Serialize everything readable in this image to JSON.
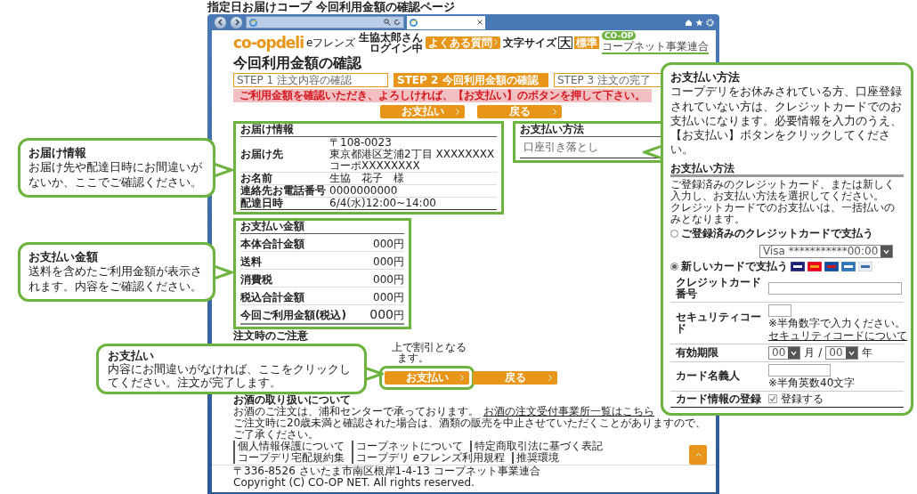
{
  "caption": "指定日お届けコープ 今回利用金額の確認ページ",
  "header": {
    "logo": "co-opdeli",
    "logo_sub": "eフレンズ",
    "user_lines": [
      "生協太郎さん",
      "ログイン中"
    ],
    "faq_button": "よくある質問",
    "font_size_label": "文字サイズ",
    "font_sizes": [
      {
        "label": "大",
        "selected": false
      },
      {
        "label": "標準",
        "selected": true
      }
    ],
    "org_badge": "CO-OP",
    "org_name": "コープネット事業連合"
  },
  "page_title": "今回利用金額の確認",
  "steps": [
    {
      "label": "STEP 1 注文内容の確認",
      "selected": false
    },
    {
      "label": "STEP 2 今回利用金額の確認",
      "selected": true
    },
    {
      "label": "STEP 3 注文の完了",
      "selected": false
    }
  ],
  "alert": "ご利用金額を確認いただき、よろしければ、【お支払い】のボタンを押して下さい。",
  "actions_top": [
    "お支払い",
    "戻る"
  ],
  "delivery": {
    "title": "お届け情報",
    "rows": [
      {
        "label": "お届け先",
        "lines": [
          "〒108-0023",
          "東京都港区芝浦2丁目 XXXXXXXX コーポXXXXXXXX"
        ]
      },
      {
        "label": "お名前",
        "lines": [
          "生協　花子　様"
        ]
      },
      {
        "label": "連絡先お電話番号",
        "lines": [
          "0000000000"
        ]
      },
      {
        "label": "配達日時",
        "lines": [
          "6/4(水)12:00~14:00"
        ]
      }
    ]
  },
  "payment_method": {
    "title": "お支払い方法",
    "value": "口座引き落とし"
  },
  "amounts": {
    "title": "お支払い金額",
    "rows": [
      {
        "label": "本体合計金額",
        "amount": "000",
        "unit": "円"
      },
      {
        "label": "送料",
        "amount": "000",
        "unit": "円"
      },
      {
        "label": "消費税",
        "amount": "000",
        "unit": "円"
      },
      {
        "label": "税込合計金額",
        "amount": "000",
        "unit": "円"
      }
    ],
    "total_label": "今回ご利用金額(税込)",
    "total_amount": "000",
    "total_unit": "円"
  },
  "notes": {
    "title": "注文時のご注意",
    "fragments": [
      "上で割引となる",
      "ます。"
    ]
  },
  "actions_bottom": [
    "お支払い",
    "戻る"
  ],
  "alcohol": {
    "title": "お酒の取り扱いについて",
    "lines": [
      "お酒のご注文は、浦和センターで承っております。",
      "ご注文時に20歳未満と確認された場合は、酒類の販売を中止させていただくことがありますので、ご了承ください。"
    ],
    "link": "お酒の注文受付事業所一覧はこちら"
  },
  "footer_links": [
    "個人情報保護について",
    "コープネットについて",
    "特定商取引法に基づく表記",
    "コープデリ宅配規約集",
    "コープデリ eフレンズ利用規程",
    "推奨環境"
  ],
  "footer_address": "〒336-8526 さいたま市南区根岸1-4-13 コープネット事業連合",
  "copyright": "Copyright (C) CO-OP NET. All rights reserved.",
  "callouts": [
    {
      "kind": "rightward",
      "title": "お届け情報",
      "text": "お届け先や配達日時にお間違いがないか、ここでご確認ください。"
    },
    {
      "kind": "rightward",
      "title": "お支払い金額",
      "text": "送料を含めたご利用金額が表示されます。内容をご確認ください。"
    },
    {
      "kind": "rightward",
      "title": "お支払い",
      "text": "内容にお間違いがなければ、ここをクリックしてください。注文が完了します。"
    },
    {
      "kind": "leftward",
      "title": "お支払い方法",
      "text": "コープデリをお休みされている方、口座登録されていない方は、クレジットカードでのお支払いになります。必要情報を入力のうえ、【お支払い】ボタンをクリックしてください。",
      "form": {
        "title": "お支払い方法",
        "intro": [
          "ご登録済みのクレジットカード、または新しく入力し、お支払い方法を選択してください。",
          "クレジットカードでのお支払いは、一括払いのみとなります。"
        ],
        "options": [
          {
            "label": "ご登録済みのクレジットカードで支払う",
            "selected": false,
            "select_value": "Visa ***********00:00"
          },
          {
            "label": "新しいカードで支払う",
            "selected": true
          }
        ],
        "card_number_label": "クレジットカード番号",
        "security_label": "セキュリティコード",
        "security_note": "※半角数字で入力ください。",
        "security_link": "セキュリティコードについて",
        "expiry_label": "有効期限",
        "month_value": "00",
        "month_unit": "月",
        "separator": "/",
        "year_value": "00",
        "year_unit": "年",
        "holder_label": "カード名義人",
        "holder_note": "※半角英数40文字",
        "register_label": "カード情報の登録",
        "register": {
          "label": "登録する",
          "checked": true
        }
      }
    }
  ]
}
